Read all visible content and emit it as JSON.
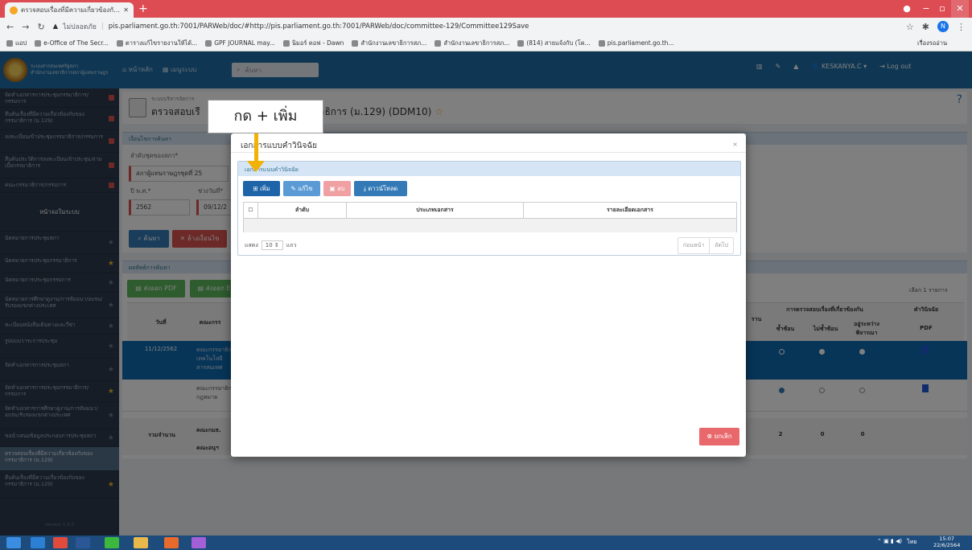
{
  "browser": {
    "tab_title": "ตรวจสอบเรื่องที่มีความเกี่ยวข้องกับรอง",
    "new_tab": "+",
    "not_secure": "ไม่ปลอดภัย",
    "url": "pis.parliament.go.th:7001/PARWeb/doc/#http://pis.parliament.go.th:7001/PARWeb/doc/committee-129/Committee129Save",
    "profile_initial": "N",
    "bookmarks": [
      "แอป",
      "e-Office of The Secr...",
      "ตารางแก้ไขรายงานให้ได้...",
      "GPF JOURNAL may...",
      "นิมอร์ คอฟ - Dawn",
      "สำนักงานเลขาธิการสภ...",
      "สำนักงานเลขาธิการสภ...",
      "(814) สายแจ้งกับ (โค...",
      "pis.parliament.go.th..."
    ],
    "reading_list": "เรื่องรออ่าน"
  },
  "app": {
    "logo_text": "ระบบสารสนเทศรัฐสภา",
    "logo_sub": "สำนักงานเลขาธิการสภาผู้แทนราษฎร",
    "nav_home": "หน้าหลัก",
    "nav_menu": "เมนูระบบ",
    "search_placeholder": "ค้นหา",
    "user": "KESKANYA.C",
    "logout": "Log out",
    "help": "?"
  },
  "sidebar": {
    "items": [
      {
        "label": "จัดทำเอกสารการประชุมกรรมาธิการ/กรรมการ",
        "marker": "square"
      },
      {
        "label": "สืบค้นเรื่องที่มีความเกี่ยวข้องกับของกรรมาธิการ (ม.129)",
        "marker": "square"
      },
      {
        "label": "ลงทะเบียนเข้าประชุมกรรมาธิการ/กรรมการ",
        "marker": "square"
      },
      {
        "label": "สืบค้นประวัติการลงทะเบียนเข้าประชุม/จ่ายเบี้ยกรรมาธิการ",
        "marker": "square"
      },
      {
        "label": "คณะกรรมาธิการ/กรรมการ",
        "marker": "square"
      },
      {
        "label": "หน้าจอในระบบ",
        "marker": "none"
      },
      {
        "label": "นัดหมายการประชุมสภา",
        "marker": "star"
      },
      {
        "label": "นัดหมายการประชุมกรรมาธิการ",
        "marker": "star-gold"
      },
      {
        "label": "นัดหมายการประชุมกรรมการ",
        "marker": "star"
      },
      {
        "label": "นัดหมายการศึกษาดูงาน/การสัมมนา/อบรม/รับรองแขกต่างประเทศ",
        "marker": "star"
      },
      {
        "label": "ทะเบียนหนังสือเดินทางและวีซ่า",
        "marker": "star"
      },
      {
        "label": "รูปแบบวาระการประชุม",
        "marker": "star"
      },
      {
        "label": "จัดทำเอกสารการประชุมสภา",
        "marker": "star"
      },
      {
        "label": "จัดทำเอกสารการประชุมกรรมาธิการ/กรรมการ",
        "marker": "star-gold"
      },
      {
        "label": "จัดทำเอกสารการศึกษาดูงาน/การสัมมนา/อบรม/รับรองแขกต่างประเทศ",
        "marker": "star"
      },
      {
        "label": "ขอนำเสนอข้อมูลประกอบการประชุมสภา",
        "marker": "star"
      },
      {
        "label": "ตรวจสอบเรื่องที่มีความเกี่ยวข้องกับของกรรมาธิการ (ม.129)",
        "marker": "none"
      },
      {
        "label": "สืบค้นเรื่องที่มีความเกี่ยวข้องกับของกรรมาธิการ (ม.129)",
        "marker": "star-gold"
      }
    ],
    "version": "Version 1.0.0"
  },
  "page": {
    "breadcrumb_small": "ระบบบริหารจัดการ",
    "title": "ตรวจสอบเรื่องที่มีความเกี่ยวข้องกับของกรรมาธิการ (ม.129) (DDM10)",
    "title_visible_left": "ตรวจสอบเรื",
    "title_visible_right": "าธิการ (ม.129) (DDM10)",
    "search_panel": "เงื่อนไขการค้นหา",
    "field_meeting_label": "ลำดับชุดของสภา*",
    "field_meeting_value": "สภาผู้แทนราษฎรชุดที่ 25",
    "field_year_label": "ปี พ.ศ.*",
    "field_year_value": "2562",
    "field_period_label": "ช่วงวันที่*",
    "field_period_value": "09/12/2",
    "btn_search": "ค้นหา",
    "btn_clear": "ล้างเงื่อนไข",
    "result_panel": "ผลลัพธ์การค้นหา",
    "btn_export_pdf": "ส่งออก PDF",
    "btn_export_excel": "ส่งออก E",
    "record_count": "เลือก 1 รายการ",
    "col_date": "วันที่",
    "col_committee": "คณะกรร",
    "col_check_group": "การตรวจสอบเรื่องที่เกี่ยวข้องกัน",
    "col_dup": "ซ้ำซ้อน",
    "col_nodup": "ไม่ซ้ำซ้อน",
    "col_pending": "อยู่ระหว่างพิจารณา",
    "col_verdict": "คำวินิจฉัย",
    "col_pdf": "PDF",
    "col_partial": "ราน",
    "rows": [
      {
        "date": "11/12/2562",
        "committee": "คณะกรรมาธิการเทคโนโลยีสารสนเทศ",
        "selected": "none"
      },
      {
        "date": "",
        "committee": "คณะกรรมาธิการกฎหมาย",
        "selected": "dup"
      }
    ],
    "total_label": "รวมจำนวน",
    "total_committee": "คณะกมธ.",
    "total_subcommittee": "คณะอนุฯ",
    "total_dup": "2",
    "total_nodup": "0",
    "total_pending": "0"
  },
  "modal": {
    "title": "เอกสารแบบคำวินิจฉัย",
    "close": "×",
    "panel_title": "เอกสารแนบคำวินิจฉัย",
    "btn_add": "เพิ่ม",
    "btn_edit": "แก้ไข",
    "btn_delete": "ลบ",
    "btn_download": "ดาวน์โหลด",
    "col_seq": "ลำดับ",
    "col_doctype": "ประเภทเอกสาร",
    "col_docdetail": "รายละเอียดเอกสาร",
    "len_prefix": "แสดง",
    "len_value": "10",
    "len_suffix": "แถว",
    "prev": "ก่อนหน้า",
    "next": "ถัดไป",
    "btn_cancel": "ยกเลิก"
  },
  "annotation": {
    "callout_text": "กด + เพิ่ม"
  },
  "taskbar": {
    "lang": "ไทย",
    "time": "15:07",
    "date": "22/6/2564"
  },
  "colors": {
    "tab_bar": "#dd4c52",
    "app_header": "#1f6fa8",
    "sidebar": "#2d3b4d",
    "btn_primary": "#337ab7",
    "btn_edit": "#5bc0de",
    "btn_delete": "#f0a0a3",
    "btn_cancel": "#e9686c",
    "arrow": "#f2b205"
  }
}
